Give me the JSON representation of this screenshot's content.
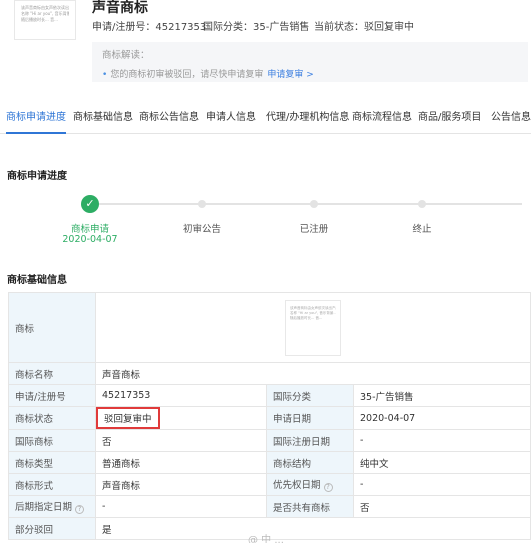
{
  "header": {
    "thumbnail_lines": [
      "该声音商标由女声依次读出产品名",
      "名称 \"Hi ar you\", 音乐背景...",
      "随后播放时长...  音..."
    ],
    "title": "声音商标",
    "reg_no": "申请/注册号：45217353",
    "intl_class": "国际分类：35-广告销售",
    "status": "当前状态：驳回复审中"
  },
  "notice": {
    "title": "商标解读：",
    "body": "您的商标初审被驳回，请尽快申请复审",
    "link": "申请复审 >"
  },
  "tabs": [
    {
      "label": "商标申请进度",
      "active": true
    },
    {
      "label": "商标基础信息",
      "active": false
    },
    {
      "label": "商标公告信息",
      "active": false
    },
    {
      "label": "申请人信息",
      "active": false
    },
    {
      "label": "代理/办理机构信息",
      "active": false
    },
    {
      "label": "商标流程信息",
      "active": false
    },
    {
      "label": "商品/服务项目",
      "active": false
    },
    {
      "label": "公告信息",
      "active": false
    }
  ],
  "progress": {
    "title": "商标申请进度",
    "steps": [
      {
        "label": "商标申请",
        "date": "2020-04-07",
        "done": true
      },
      {
        "label": "初审公告",
        "date": "",
        "done": false
      },
      {
        "label": "已注册",
        "date": "",
        "done": false
      },
      {
        "label": "终止",
        "date": "",
        "done": false
      }
    ],
    "check_glyph": "✓"
  },
  "basic": {
    "title": "商标基础信息",
    "image_label": "商标",
    "image_lines": [
      "该声音商标由女声依次读出产品名",
      "名称 \"Hi ar you\", 音乐背景...",
      "随后播放时长... 音..."
    ],
    "rows": [
      {
        "k1": "商标名称",
        "v1": "声音商标",
        "k2": "",
        "v2": ""
      },
      {
        "k1": "申请/注册号",
        "v1": "45217353",
        "k2": "国际分类",
        "v2": "35-广告销售"
      },
      {
        "k1": "商标状态",
        "v1": "驳回复审中",
        "k2": "申请日期",
        "v2": "2020-04-07"
      },
      {
        "k1": "国际商标",
        "v1": "否",
        "k2": "国际注册日期",
        "v2": "-"
      },
      {
        "k1": "商标类型",
        "v1": "普通商标",
        "k2": "商标结构",
        "v2": "纯中文"
      },
      {
        "k1": "商标形式",
        "v1": "声音商标",
        "k2": "优先权日期",
        "v2": "-"
      },
      {
        "k1": "后期指定日期",
        "v1": "-",
        "k2": "是否共有商标",
        "v2": "否"
      },
      {
        "k1": "部分驳回",
        "v1": "是",
        "k2": "",
        "v2": ""
      }
    ]
  },
  "colors": {
    "accent": "#2f76d6",
    "success": "#2dad64",
    "highlight": "#e03a3a",
    "label_bg": "#eef6fb"
  },
  "watermark": "@ 中 ..."
}
